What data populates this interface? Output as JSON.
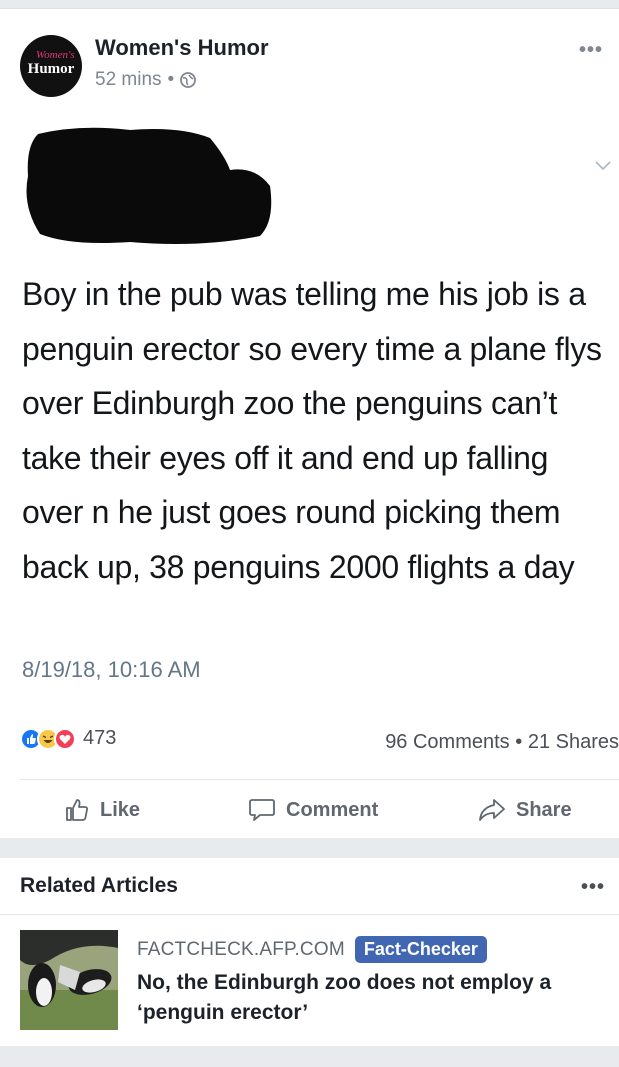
{
  "post": {
    "page_name": "Women's Humor",
    "avatar_text_top": "Women's",
    "avatar_text_bottom": "Humor",
    "time": "52 mins",
    "separator": "•",
    "menu": "•••"
  },
  "tweet": {
    "text": "Boy in the pub was telling me his job is a penguin erector so every time a plane flys over Edinburgh zoo the penguins can’t take their eyes off it and end up falling over n he just goes round picking them back up, 38 penguins 2000 flights a day",
    "date": "8/19/18, 10:16 AM"
  },
  "engagement": {
    "reactions_count": "473",
    "comments": "96 Comments",
    "dot": "•",
    "shares": "21 Shares"
  },
  "actions": {
    "like": "Like",
    "comment": "Comment",
    "share": "Share"
  },
  "related": {
    "title": "Related Articles",
    "menu": "•••",
    "source": "FACTCHECK.AFP.COM",
    "badge": "Fact-Checker",
    "article_title": "No, the Edinburgh zoo does not employ a ‘penguin erector’"
  },
  "colors": {
    "link_blue": "#4267b2",
    "like_blue": "#1877f2",
    "love_red": "#f33e58",
    "haha_yellow": "#f7c94b"
  },
  "icons": [
    "globe-icon",
    "chevron-down-icon",
    "like-reaction-icon",
    "haha-reaction-icon",
    "love-reaction-icon",
    "thumbs-up-icon",
    "comment-icon",
    "share-icon"
  ]
}
